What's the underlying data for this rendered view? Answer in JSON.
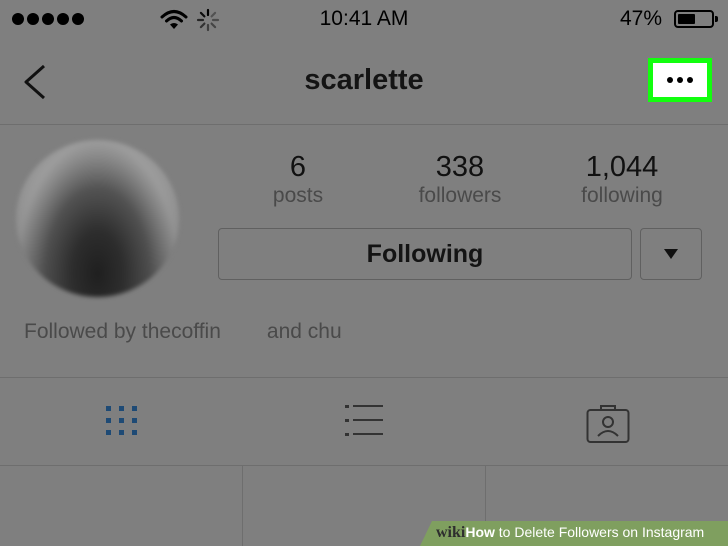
{
  "status_bar": {
    "time": "10:41 AM",
    "battery_percent": "47%",
    "battery_level": 0.47,
    "signal_dots": 5,
    "icons": [
      "signal-dots-icon",
      "wifi-icon",
      "loading-spinner-icon",
      "battery-icon"
    ]
  },
  "nav": {
    "title": "scarlette",
    "back_icon": "chevron-left-icon",
    "more_icon": "ellipsis-icon",
    "highlight_color": "#12ff0e"
  },
  "profile": {
    "stats": [
      {
        "value": "6",
        "label": "posts"
      },
      {
        "value": "338",
        "label": "followers"
      },
      {
        "value": "1,044",
        "label": "following"
      }
    ],
    "following_label": "Following",
    "dropdown_icon": "caret-down-icon",
    "followed_by": "Followed by thecoffin",
    "followed_by_extra": "and chu"
  },
  "tabs": [
    {
      "name": "grid-view",
      "icon": "grid-icon",
      "active": true,
      "color": "#1e4a75"
    },
    {
      "name": "list-view",
      "icon": "list-icon",
      "active": false
    },
    {
      "name": "tagged-photos",
      "icon": "tagged-person-icon",
      "active": false
    }
  ],
  "watermark": {
    "wiki": "wiki",
    "how": "How",
    "rest": " to Delete Followers on Instagram"
  }
}
